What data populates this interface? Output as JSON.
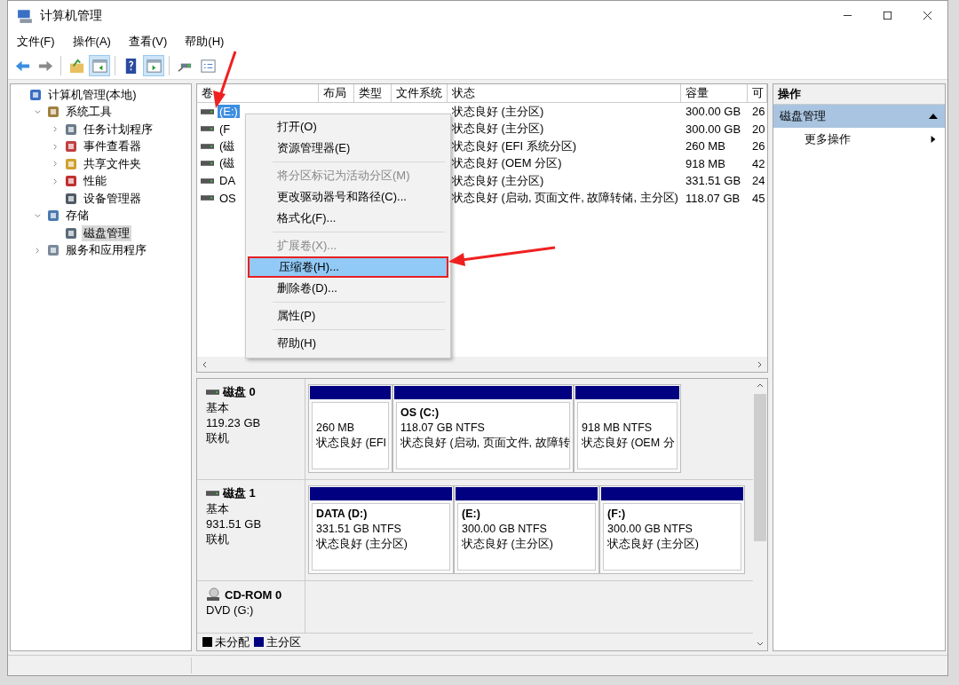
{
  "window": {
    "title": "计算机管理"
  },
  "menu_bar": [
    {
      "label": "文件(F)"
    },
    {
      "label": "操作(A)"
    },
    {
      "label": "查看(V)"
    },
    {
      "label": "帮助(H)"
    }
  ],
  "toolbar": [
    {
      "pressed": false
    },
    {
      "pressed": false
    },
    {
      "pressed": false
    },
    {
      "pressed": true
    },
    {
      "pressed": false
    },
    {
      "pressed": true
    },
    {
      "pressed": false
    },
    {
      "pressed": false
    }
  ],
  "tree": [
    {
      "label": "计算机管理(本地)",
      "selected": false,
      "children": [
        {
          "label": "系统工具",
          "expanded": true,
          "selected": false,
          "children": [
            {
              "label": "任务计划程序",
              "expanded": false,
              "selected": false
            },
            {
              "label": "事件查看器",
              "expanded": false,
              "selected": false
            },
            {
              "label": "共享文件夹",
              "expanded": false,
              "selected": false
            },
            {
              "label": "性能",
              "expanded": false,
              "selected": false
            },
            {
              "label": "设备管理器",
              "selected": false
            }
          ]
        },
        {
          "label": "存储",
          "expanded": true,
          "selected": false,
          "children": [
            {
              "label": "磁盘管理",
              "selected": true
            }
          ]
        },
        {
          "label": "服务和应用程序",
          "expanded": false,
          "selected": false
        }
      ]
    }
  ],
  "table": {
    "columns": [
      "卷",
      "布局",
      "类型",
      "文件系统",
      "状态",
      "容量",
      "可"
    ],
    "rows": [
      {
        "volume": "(E:)",
        "status": "状态良好 (主分区)",
        "capacity": "300.00 GB",
        "free": "26",
        "selected": true
      },
      {
        "volume": "(F",
        "status": "状态良好 (主分区)",
        "capacity": "300.00 GB",
        "free": "20",
        "selected": false
      },
      {
        "volume": "(磁",
        "status": "状态良好 (EFI 系统分区)",
        "capacity": "260 MB",
        "free": "26",
        "selected": false
      },
      {
        "volume": "(磁",
        "status": "状态良好 (OEM 分区)",
        "capacity": "918 MB",
        "free": "42",
        "selected": false
      },
      {
        "volume": "DA",
        "status": "状态良好 (主分区)",
        "capacity": "331.51 GB",
        "free": "24",
        "selected": false
      },
      {
        "volume": "OS",
        "status": "状态良好 (启动, 页面文件, 故障转储, 主分区)",
        "capacity": "118.07 GB",
        "free": "45",
        "selected": false
      }
    ]
  },
  "context_menu": [
    {
      "kind": "item",
      "label": "打开(O)",
      "disabled": false,
      "highlighted": false
    },
    {
      "kind": "item",
      "label": "资源管理器(E)",
      "disabled": false,
      "highlighted": false
    },
    {
      "kind": "separator"
    },
    {
      "kind": "item",
      "label": "将分区标记为活动分区(M)",
      "disabled": true,
      "highlighted": false
    },
    {
      "kind": "item",
      "label": "更改驱动器号和路径(C)...",
      "disabled": false,
      "highlighted": false
    },
    {
      "kind": "item",
      "label": "格式化(F)...",
      "disabled": false,
      "highlighted": false
    },
    {
      "kind": "separator"
    },
    {
      "kind": "item",
      "label": "扩展卷(X)...",
      "disabled": true,
      "highlighted": false
    },
    {
      "kind": "item",
      "label": "压缩卷(H)...",
      "disabled": false,
      "highlighted": true
    },
    {
      "kind": "item",
      "label": "删除卷(D)...",
      "disabled": false,
      "highlighted": false
    },
    {
      "kind": "separator"
    },
    {
      "kind": "item",
      "label": "属性(P)",
      "disabled": false,
      "highlighted": false
    },
    {
      "kind": "separator"
    },
    {
      "kind": "item",
      "label": "帮助(H)",
      "disabled": false,
      "highlighted": false
    }
  ],
  "disks": [
    {
      "kind": "disk",
      "name": "磁盘 0",
      "type": "基本",
      "size": "119.23 GB",
      "state": "联机",
      "partitions": [
        {
          "size": "260 MB",
          "status": "状态良好 (EFI"
        },
        {
          "name": "OS  (C:)",
          "size": "118.07 GB NTFS",
          "status": "状态良好 (启动, 页面文件, 故障转"
        },
        {
          "size": "918 MB NTFS",
          "status": "状态良好 (OEM 分"
        }
      ]
    },
    {
      "kind": "disk",
      "name": "磁盘 1",
      "type": "基本",
      "size": "931.51 GB",
      "state": "联机",
      "partitions": [
        {
          "name": "DATA  (D:)",
          "size": "331.51 GB NTFS",
          "status": "状态良好 (主分区)"
        },
        {
          "name": "(E:)",
          "size": "300.00 GB NTFS",
          "status": "状态良好 (主分区)"
        },
        {
          "name": "(F:)",
          "size": "300.00 GB NTFS",
          "status": "状态良好 (主分区)"
        }
      ]
    },
    {
      "kind": "cdrom",
      "name": "CD-ROM 0",
      "type": "DVD (G:)"
    }
  ],
  "legend": [
    {
      "label": "未分配",
      "color": "#000000"
    },
    {
      "label": "主分区",
      "color": "#000080"
    }
  ],
  "actions": {
    "header": "操作",
    "section": {
      "label": "磁盘管理",
      "expanded": true
    },
    "items": [
      {
        "label": "更多操作"
      }
    ]
  }
}
